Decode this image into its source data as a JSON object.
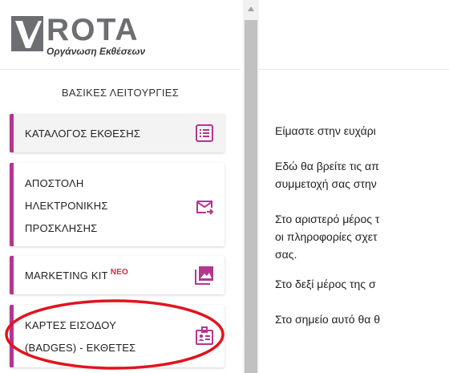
{
  "logo": {
    "name": "ROTA",
    "subtitle": "Οργάνωση Εκθέσεων",
    "colors": {
      "mark": "#6d6e71",
      "accent": "#ffffff"
    }
  },
  "sidebar": {
    "section_title": "ΒΑΣΙΚΕΣ ΛΕΙΤΟΥΡΓΙΕΣ",
    "accent_color": "#b5368f",
    "items": [
      {
        "lines": [
          "ΚΑΤΑΛΟΓΟΣ ΕΚΘΕΣΗΣ"
        ],
        "icon": "list-icon"
      },
      {
        "lines": [
          "ΑΠΟΣΤΟΛΗ",
          "ΗΛΕΚΤΡΟΝΙΚΗΣ",
          "ΠΡΟΣΚΛΗΣΗΣ"
        ],
        "icon": "mail-send-icon"
      },
      {
        "lines": [
          "MARKETING KIT"
        ],
        "badge": "ΝΕΟ",
        "icon": "image-icon"
      },
      {
        "lines": [
          "ΚΑΡΤΕΣ ΕΙΣΟΔΟΥ",
          "(BADGES) - ΕΚΘΕΤΕΣ"
        ],
        "icon": "badge-id-icon"
      }
    ]
  },
  "annotation": {
    "color": "#e0141e"
  },
  "main": {
    "paragraphs": [
      [
        "Είμαστε στην ευχάρι"
      ],
      [
        "Εδώ θα βρείτε τις απ",
        "συμμετοχή σας στην"
      ],
      [
        "Στο αριστερό μέρος τ",
        "οι πληροφορίες σχετ",
        "σας."
      ],
      [
        "Στο δεξί μέρος της σ"
      ],
      [
        "Στο σημείο αυτό θα θ"
      ]
    ]
  }
}
